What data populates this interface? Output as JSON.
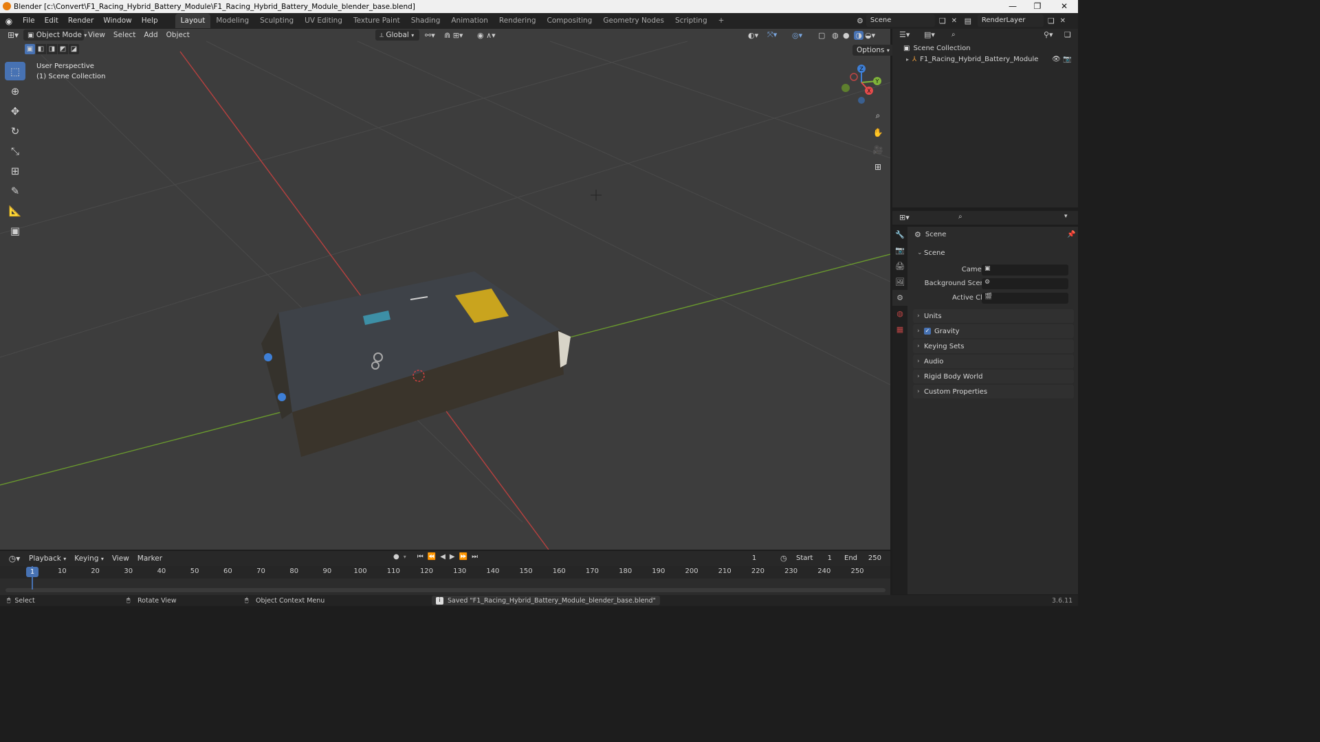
{
  "window": {
    "title": "Blender [c:\\Convert\\F1_Racing_Hybrid_Battery_Module\\F1_Racing_Hybrid_Battery_Module_blender_base.blend]",
    "minimize": "—",
    "restore": "❐",
    "close": "✕"
  },
  "menu": [
    "File",
    "Edit",
    "Render",
    "Window",
    "Help"
  ],
  "workspaces": [
    "Layout",
    "Modeling",
    "Sculpting",
    "UV Editing",
    "Texture Paint",
    "Shading",
    "Animation",
    "Rendering",
    "Compositing",
    "Geometry Nodes",
    "Scripting"
  ],
  "workspace_add": "+",
  "scene_selector": "Scene",
  "renderlayer_selector": "RenderLayer",
  "viewport": {
    "mode": "Object Mode",
    "menus": [
      "View",
      "Select",
      "Add",
      "Object"
    ],
    "orientation": "Global",
    "options": "Options",
    "info_line1": "User Perspective",
    "info_line2": "(1) Scene Collection",
    "gizmo": {
      "x": "X",
      "y": "Y",
      "z": "Z"
    }
  },
  "outliner": {
    "root": "Scene Collection",
    "items": [
      {
        "name": "F1_Racing_Hybrid_Battery_Module"
      }
    ]
  },
  "properties": {
    "context_title": "Scene",
    "section_scene": "Scene",
    "camera_label": "Camera",
    "background_scene_label": "Background Scene",
    "active_clip_label": "Active Clip",
    "panels": [
      "Units",
      "Gravity",
      "Keying Sets",
      "Audio",
      "Rigid Body World",
      "Custom Properties"
    ],
    "gravity_checked": true
  },
  "timeline": {
    "menus": [
      "Playback",
      "Keying",
      "View",
      "Marker"
    ],
    "current_frame": "1",
    "start_label": "Start",
    "start_value": "1",
    "end_label": "End",
    "end_value": "250",
    "ticks": [
      "1",
      "10",
      "20",
      "30",
      "40",
      "50",
      "60",
      "70",
      "80",
      "90",
      "100",
      "110",
      "120",
      "130",
      "140",
      "150",
      "160",
      "170",
      "180",
      "190",
      "200",
      "210",
      "220",
      "230",
      "240",
      "250"
    ]
  },
  "statusbar": {
    "select": "Select",
    "rotate": "Rotate View",
    "context_menu": "Object Context Menu",
    "message": "Saved \"F1_Racing_Hybrid_Battery_Module_blender_base.blend\"",
    "version": "3.6.11"
  },
  "colors": {
    "accent": "#4772b3",
    "x_axis": "#e54b4b",
    "y_axis": "#7fb33a",
    "z_axis": "#3e7fd6",
    "viewport_bg": "#3d3d3d"
  }
}
